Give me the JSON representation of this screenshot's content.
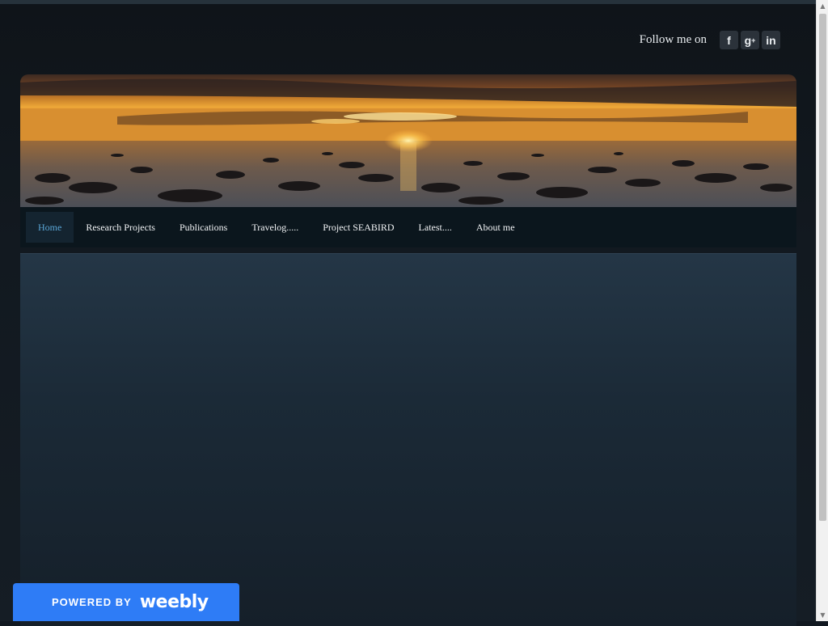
{
  "header": {
    "follow_label": "Follow me on",
    "social": [
      {
        "name": "facebook",
        "glyph": "f"
      },
      {
        "name": "google-plus",
        "glyph": "g+"
      },
      {
        "name": "linkedin",
        "glyph": "in"
      }
    ]
  },
  "nav": {
    "items": [
      {
        "label": "Home",
        "active": true
      },
      {
        "label": "Research Projects"
      },
      {
        "label": "Publications"
      },
      {
        "label": "Travelog....."
      },
      {
        "label": "Project SEABIRD"
      },
      {
        "label": "Latest...."
      },
      {
        "label": "About me"
      }
    ]
  },
  "footer_badge": {
    "powered_by": "POWERED BY",
    "brand": "weebly"
  },
  "colors": {
    "nav_active_text": "#5aa6d6",
    "badge_blue": "#2e7cf6",
    "page_bg": "#111820"
  },
  "icons": {
    "facebook": "facebook-icon",
    "google_plus": "google-plus-icon",
    "linkedin": "linkedin-icon"
  }
}
